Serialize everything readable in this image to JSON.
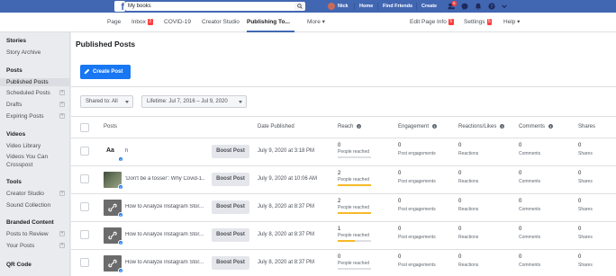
{
  "topbar": {
    "search_value": "My books",
    "user_name": "Nick",
    "nav": [
      "Home",
      "Find Friends",
      "Create"
    ],
    "friend_requests_badge": "5",
    "colors": {
      "brand": "#4267b2",
      "badge": "#fa3e3e"
    }
  },
  "pagebar": {
    "tabs": [
      {
        "label": "Page"
      },
      {
        "label": "Inbox",
        "badge": "2"
      },
      {
        "label": "COVID-19"
      },
      {
        "label": "Creator Studio"
      },
      {
        "label": "Publishing To..."
      },
      {
        "label": "More ▾"
      }
    ],
    "right": [
      {
        "label": "Edit Page Info",
        "badge": "5"
      },
      {
        "label": "Settings",
        "badge": "5"
      },
      {
        "label": "Help ▾"
      }
    ]
  },
  "sidebar": {
    "sections": [
      {
        "heading": "Stories",
        "items": [
          "Story Archive"
        ]
      },
      {
        "heading": "Posts",
        "items": [
          "Published Posts",
          "Scheduled Posts",
          "Drafts",
          "Expiring Posts"
        ]
      },
      {
        "heading": "Videos",
        "items": [
          "Video Library",
          "Videos You Can Crosspost"
        ]
      },
      {
        "heading": "Tools",
        "items": [
          "Creator Studio",
          "Sound Collection"
        ]
      },
      {
        "heading": "Branded Content",
        "items": [
          "Posts to Review",
          "Your Posts"
        ]
      },
      {
        "heading": "QR Code",
        "items": []
      }
    ]
  },
  "main": {
    "title": "Published Posts",
    "create_button": "Create Post",
    "filter_shared": "Shared to: All",
    "filter_lifetime": "Lifetime: Jul 7, 2016 – Jul 9, 2020",
    "columns": [
      "Posts",
      "Date Published",
      "Reach",
      "Engagement",
      "Reactions/Likes",
      "Comments",
      "Shares"
    ],
    "boost_label": "Boost Post",
    "metric_labels": {
      "reach": "People reached",
      "engagement": "Post engagements",
      "reactions": "Reactions",
      "comments": "Comments",
      "shares": "Shares"
    },
    "rows": [
      {
        "thumb": "Aa",
        "title": "h",
        "date": "July 9, 2020 at 3:18 PM",
        "reach": "0",
        "reach_fill": 0,
        "engagement": "0",
        "reactions": "0",
        "comments": "0",
        "shares": "0"
      },
      {
        "thumb": "",
        "title": "'Don't be a tosser': Why Covid-1...",
        "date": "July 9, 2020 at 10:06 AM",
        "reach": "2",
        "reach_fill": 1.0,
        "engagement": "0",
        "reactions": "0",
        "comments": "0",
        "shares": "0"
      },
      {
        "thumb": "",
        "title": "How to Analyze Instagram Stor...",
        "date": "July 8, 2020 at 8:37 PM",
        "reach": "2",
        "reach_fill": 1.0,
        "engagement": "0",
        "reactions": "0",
        "comments": "0",
        "shares": "0"
      },
      {
        "thumb": "",
        "title": "How to Analyze Instagram Stor...",
        "date": "July 8, 2020 at 8:37 PM",
        "reach": "1",
        "reach_fill": 0.5,
        "engagement": "0",
        "reactions": "0",
        "comments": "0",
        "shares": "0"
      },
      {
        "thumb": "",
        "title": "How to Analyze Instagram Stor...",
        "date": "July 8, 2020 at 8:37 PM",
        "reach": "0",
        "reach_fill": 0,
        "engagement": "0",
        "reactions": "0",
        "comments": "0",
        "shares": "0"
      }
    ]
  }
}
